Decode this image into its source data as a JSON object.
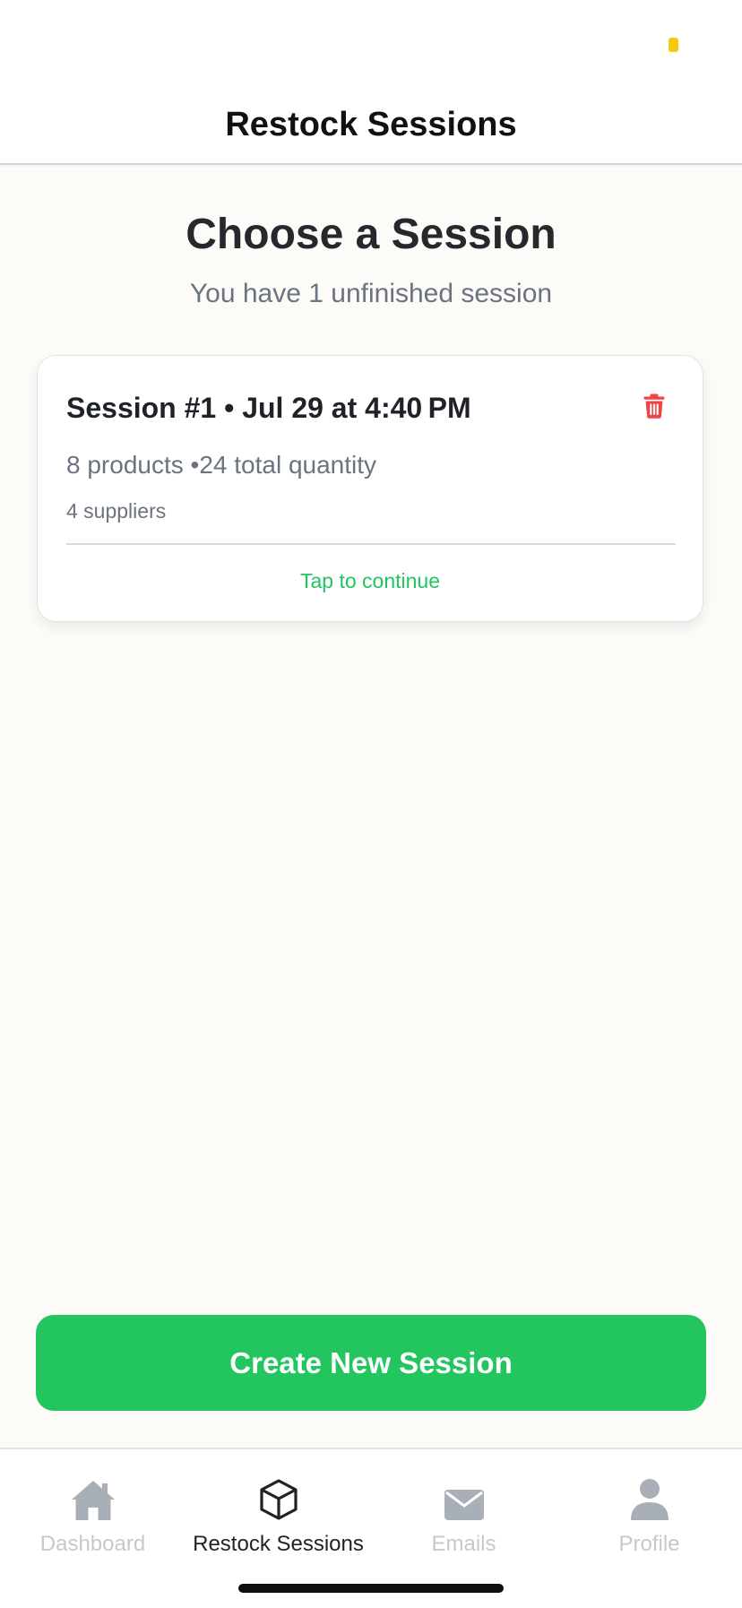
{
  "header": {
    "title": "Restock Sessions"
  },
  "main": {
    "title": "Choose a Session",
    "subtitle": "You have 1 unfinished session"
  },
  "session_card": {
    "title": "Session #1 • Jul 29 at 4:40 PM",
    "stats": "8 products •24 total quantity",
    "suppliers": "4 suppliers",
    "action": "Tap to continue",
    "delete_icon": "trash-icon"
  },
  "create_button": {
    "label": "Create New Session"
  },
  "tabs": [
    {
      "label": "Dashboard",
      "icon": "home-icon",
      "active": false
    },
    {
      "label": "Restock Sessions",
      "icon": "box-icon",
      "active": true
    },
    {
      "label": "Emails",
      "icon": "mail-icon",
      "active": false
    },
    {
      "label": "Profile",
      "icon": "person-icon",
      "active": false
    }
  ],
  "colors": {
    "accent_green": "#22C55E",
    "delete_red": "#EF4444",
    "background": "#FCFBF8",
    "status_dot": "#F2CC0C",
    "inactive_tab": "#C5C9CE"
  }
}
